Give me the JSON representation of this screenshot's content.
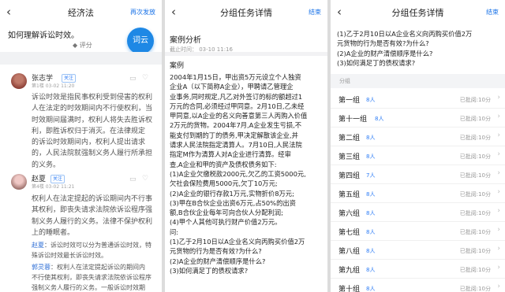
{
  "left": {
    "back_icon": "‹",
    "title": "经济法",
    "action": "再次发放",
    "question": "如何理解诉讼时效。",
    "rate_icon": "◆",
    "rate_label": "评分",
    "cloud_label": "词云",
    "comment1": {
      "user": "张志学",
      "tag": "关注",
      "meta": "第1楼  03-02 11:20",
      "lines": [
        "诉讼时效是指民事权利受到侵害的权利",
        "人在法定的时效期间内不行使权利，当",
        "时效期间届满时，权利人将失去胜诉权",
        "利，即胜诉权归于消灭。在法律规定",
        "的诉讼时效期间内，权利人提出请求",
        "的，人民法院就强制义务人履行所承担",
        "的义务。"
      ]
    },
    "comment2": {
      "user": "赵夏",
      "tag": "关注",
      "meta": "第4楼  03-02 11:21",
      "lines": [
        "权利人在法定提起的诉讼期间内不行事",
        "其权利，即丧失请求法院依诉讼程序强",
        "制义务人履行的义务。法律不保护权利",
        "上的睡眠者。"
      ]
    },
    "reply1": {
      "name": "赵夏",
      "text": "：诉讼时效可以分为普通诉讼时效，特",
      "text2": "殊诉讼时效最长诉讼时效。"
    },
    "reply2": {
      "name": "郭灵蓉",
      "text": "：权利人在法定提起诉讼的期间内",
      "text2": "不行使其权利，即丧失请求法院依诉讼程序",
      "text3": "强制义务人履行的义务。一般诉讼时效期"
    }
  },
  "middle": {
    "back_icon": "‹",
    "title": "分组任务详情",
    "action": "结束",
    "section": "案例分析",
    "deadline": "截止时间： 03-10 11:16",
    "case_title": "案例",
    "lines": [
      "2004年1月15日，甲出资5万元设立个人独资",
      "企业A（以下简称A企业），甲聘请乙管理企",
      "业事务,同时规定,凡乙对外签订的标的额超过1",
      "万元的合同,必须经过甲同意。2月10日,乙未经",
      "甲同意,以A企业的名义向善意第三人丙购入价值",
      "2万元的货物。2004年7月,A企业发生亏损,不",
      "能支付到期的丁的债务,甲决定解散该企业,并",
      "请求人民法院指定清算人。7月10日,人民法院",
      "指定M作为清算人对A企业进行清算。经审",
      "查,A企业和甲的资产及债权债务如下:",
      "(1)A企业欠缴税款2000元,欠乙的工资5000元,",
      "欠社会保险费用5000元,欠丁10万元;",
      "(2)A企业的银行存款1万元,实物折价8万元;",
      "(3)甲在B合伙企业出资6万元,占50%的出资",
      "额,B合伙企业每年可向合伙人分配利润;",
      "(4)甲个人其他可执行财产价值2万元。",
      "问:",
      "(1)乙于2月10日以A企业名义向丙购买价值2万",
      "元货物的行为是否有效?为什么?",
      "(2)A企业的财产清偿顺序是什么?",
      "(3)如何满足丁的债权请求?"
    ]
  },
  "right": {
    "back_icon": "‹",
    "title": "分组任务详情",
    "action": "结束",
    "lines": [
      "(1)乙于2月10日以A企业名义向丙购买价值2万",
      "元货物的行为是否有效?为什么?",
      "(2)A企业的财产清偿顺序是什么?",
      "(3)如何满足丁的债权请求?"
    ],
    "section_label": "分组",
    "chevron_icon": "›",
    "groups": [
      {
        "name": "第一组",
        "count": "8人",
        "status": "已批阅:10分"
      },
      {
        "name": "第十一组",
        "count": "8人",
        "status": "已批阅:10分"
      },
      {
        "name": "第二组",
        "count": "8人",
        "status": "已批阅:10分"
      },
      {
        "name": "第三组",
        "count": "8人",
        "status": "已批阅:10分"
      },
      {
        "name": "第四组",
        "count": "7人",
        "status": "已批阅:10分"
      },
      {
        "name": "第五组",
        "count": "8人",
        "status": "已批阅:10分"
      },
      {
        "name": "第六组",
        "count": "8人",
        "status": "已批阅:10分"
      },
      {
        "name": "第七组",
        "count": "8人",
        "status": "已批阅:10分"
      },
      {
        "name": "第八组",
        "count": "8人",
        "status": "已批阅:10分"
      },
      {
        "name": "第九组",
        "count": "8人",
        "status": "已批阅:10分"
      },
      {
        "name": "第十组",
        "count": "8人",
        "status": "已批阅:10分"
      }
    ]
  }
}
